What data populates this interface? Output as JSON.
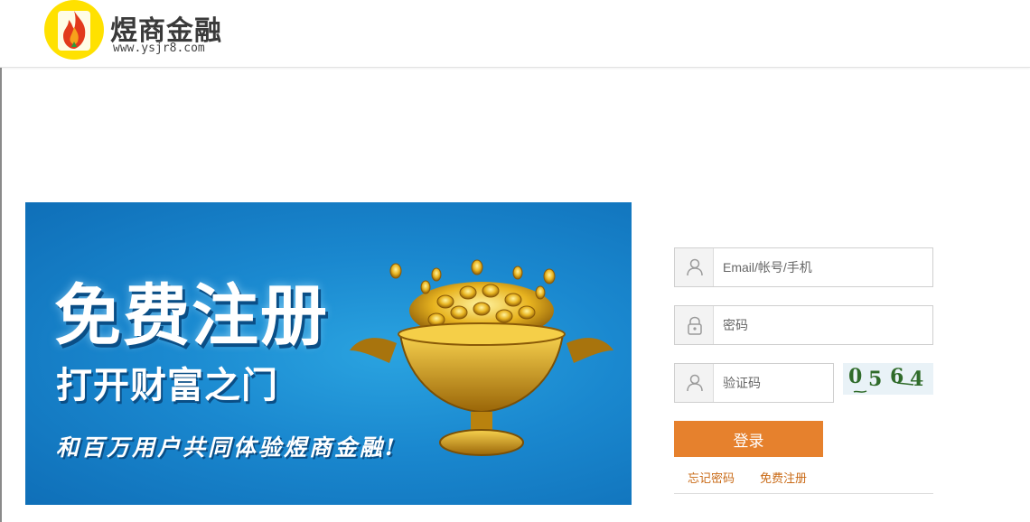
{
  "header": {
    "brand_name": "煜商金融",
    "brand_url": "www.ysjr8.com"
  },
  "banner": {
    "headline": "免费注册",
    "subtitle": "打开财富之门",
    "tagline": "和百万用户共同体验煜商金融!"
  },
  "login": {
    "username_placeholder": "Email/帐号/手机",
    "password_placeholder": "密码",
    "captcha_placeholder": "验证码",
    "captcha_code": [
      "0",
      "5",
      "6",
      "4"
    ],
    "submit_label": "登录",
    "forgot_label": "忘记密码",
    "register_label": "免费注册"
  },
  "colors": {
    "accent": "#e6812d",
    "link": "#c96a16",
    "logo_bg": "#ffe100",
    "banner_bg": "#1a88cf"
  },
  "icons": {
    "logo": "flame-logo-icon",
    "username": "user-icon",
    "password": "lock-icon",
    "captcha": "user-icon"
  }
}
